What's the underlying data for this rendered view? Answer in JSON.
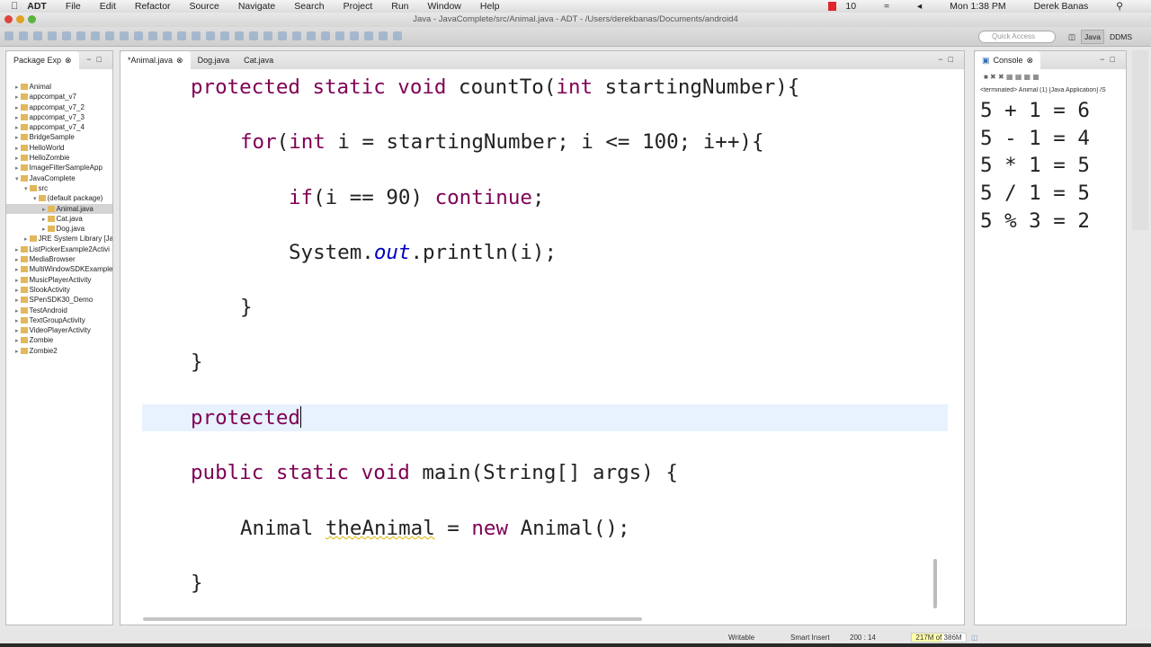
{
  "menubar": {
    "app": "ADT",
    "items": [
      "File",
      "Edit",
      "Refactor",
      "Source",
      "Navigate",
      "Search",
      "Project",
      "Run",
      "Window",
      "Help"
    ],
    "status_num": "10",
    "clock": "Mon 1:38 PM",
    "user": "Derek Banas"
  },
  "window": {
    "title": "Java - JavaComplete/src/Animal.java - ADT - /Users/derekbanas/Documents/android4"
  },
  "toolbar": {
    "quick_access_placeholder": "Quick Access",
    "perspectives": [
      "Java",
      "DDMS"
    ]
  },
  "package_explorer": {
    "title": "Package Exp",
    "items": [
      {
        "label": "Animal",
        "indent": 0
      },
      {
        "label": "appcompat_v7",
        "indent": 0
      },
      {
        "label": "appcompat_v7_2",
        "indent": 0
      },
      {
        "label": "appcompat_v7_3",
        "indent": 0
      },
      {
        "label": "appcompat_v7_4",
        "indent": 0
      },
      {
        "label": "BridgeSample",
        "indent": 0
      },
      {
        "label": "HelloWorld",
        "indent": 0
      },
      {
        "label": "HelloZombie",
        "indent": 0
      },
      {
        "label": "ImageFilterSampleApp",
        "indent": 0
      },
      {
        "label": "JavaComplete",
        "indent": 0,
        "expanded": true
      },
      {
        "label": "src",
        "indent": 1,
        "expanded": true
      },
      {
        "label": "(default package)",
        "indent": 2,
        "expanded": true
      },
      {
        "label": "Animal.java",
        "indent": 3,
        "selected": true
      },
      {
        "label": "Cat.java",
        "indent": 3
      },
      {
        "label": "Dog.java",
        "indent": 3
      },
      {
        "label": "JRE System Library [Ja",
        "indent": 1
      },
      {
        "label": "ListPickerExample2Activi",
        "indent": 0
      },
      {
        "label": "MediaBrowser",
        "indent": 0
      },
      {
        "label": "MultiWindowSDKExample",
        "indent": 0
      },
      {
        "label": "MusicPlayerActivity",
        "indent": 0
      },
      {
        "label": "SlookActivity",
        "indent": 0
      },
      {
        "label": "SPenSDK30_Demo",
        "indent": 0
      },
      {
        "label": "TestAndroid",
        "indent": 0
      },
      {
        "label": "TextGroupActivity",
        "indent": 0
      },
      {
        "label": "VideoPlayerActivity",
        "indent": 0
      },
      {
        "label": "Zombie",
        "indent": 0
      },
      {
        "label": "Zombie2",
        "indent": 0
      }
    ]
  },
  "editor": {
    "tabs": [
      "*Animal.java",
      "Dog.java",
      "Cat.java"
    ],
    "code": {
      "l1": [
        "protected",
        " ",
        "static",
        " ",
        "void",
        " countTo(",
        "int",
        " startingNumber){"
      ],
      "l2": [
        "for",
        "(",
        "int",
        " i = startingNumber; i <= 100; i++){"
      ],
      "l3": [
        "if",
        "(i == 90) ",
        "continue",
        ";"
      ],
      "l4": [
        "System.",
        "out",
        ".println(i);"
      ],
      "l5": "}",
      "l6": "}",
      "l7": "protected",
      "l8": [
        "public",
        " ",
        "static",
        " ",
        "void",
        " main(String[] args) {"
      ],
      "l9": [
        "Animal ",
        "theAnimal",
        " = ",
        "new",
        " Animal();"
      ],
      "l10": "}"
    }
  },
  "console": {
    "title": "Console",
    "terminated": "<terminated> Animal (1) [Java Application] /S",
    "output": [
      "5 + 1 = 6",
      "5 - 1 = 4",
      "5 * 1 = 5",
      "5 / 1 = 5",
      "5 % 3 = 2"
    ]
  },
  "status": {
    "writable": "Writable",
    "insert_mode": "Smart Insert",
    "position": "200 : 14",
    "heap": "217M of 386M",
    "heap_fraction": 0.56
  },
  "colors": {
    "keyword": "#7f0055",
    "field": "#0000c0",
    "current_line": "#e8f2fe"
  }
}
